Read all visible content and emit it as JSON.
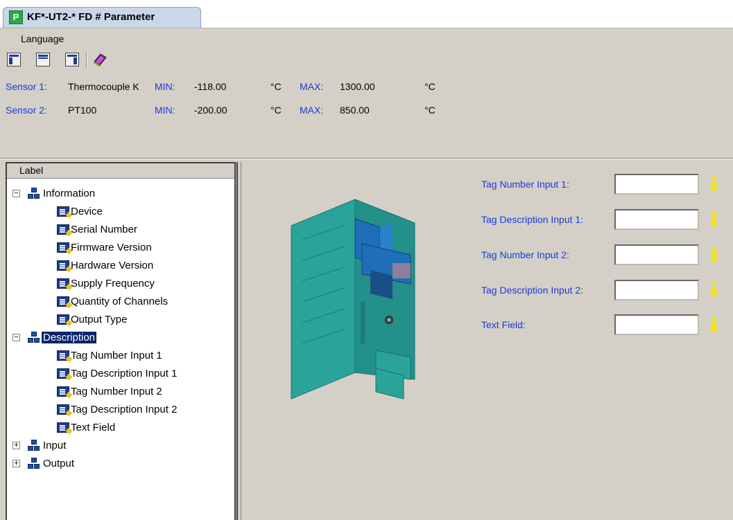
{
  "tab": {
    "title": "KF*-UT2-* FD # Parameter",
    "logo_letter": "P"
  },
  "menu": {
    "items": [
      "Language"
    ]
  },
  "toolbar": {
    "icons": [
      "layout-left-icon",
      "layout-top-icon",
      "layout-right-icon",
      "book-icon"
    ]
  },
  "sensors": [
    {
      "label": "Sensor 1:",
      "type": "Thermocouple K",
      "min_label": "MIN:",
      "min": "-118.00",
      "unit1": "°C",
      "max_label": "MAX:",
      "max": "1300.00",
      "unit2": "°C"
    },
    {
      "label": "Sensor 2:",
      "type": "PT100",
      "min_label": "MIN:",
      "min": "-200.00",
      "unit1": "°C",
      "max_label": "MAX:",
      "max": "850.00",
      "unit2": "°C"
    }
  ],
  "tree": {
    "header": "Label",
    "groups": [
      {
        "label": "Information",
        "expanded": true,
        "children": [
          "Device",
          "Serial Number",
          "Firmware Version",
          "Hardware Version",
          "Supply Frequency",
          "Quantity of Channels",
          "Output Type"
        ]
      },
      {
        "label": "Description",
        "expanded": true,
        "selected": true,
        "children": [
          "Tag Number Input 1",
          "Tag Description Input 1",
          "Tag Number Input 2",
          "Tag Description Input 2",
          "Text Field"
        ]
      },
      {
        "label": "Input",
        "expanded": false,
        "children": []
      },
      {
        "label": "Output",
        "expanded": false,
        "children": []
      }
    ]
  },
  "form": {
    "fields": [
      {
        "label": "Tag Number Input 1:",
        "value": ""
      },
      {
        "label": "Tag Description Input 1:",
        "value": ""
      },
      {
        "label": "Tag Number Input 2:",
        "value": ""
      },
      {
        "label": "Tag Description Input 2:",
        "value": ""
      },
      {
        "label": "Text Field:",
        "value": ""
      }
    ]
  },
  "colors": {
    "label_blue": "#1a3ad6",
    "selection": "#0a246a",
    "info_yellow": "#f4e600",
    "device_teal": "#2ba59e"
  }
}
